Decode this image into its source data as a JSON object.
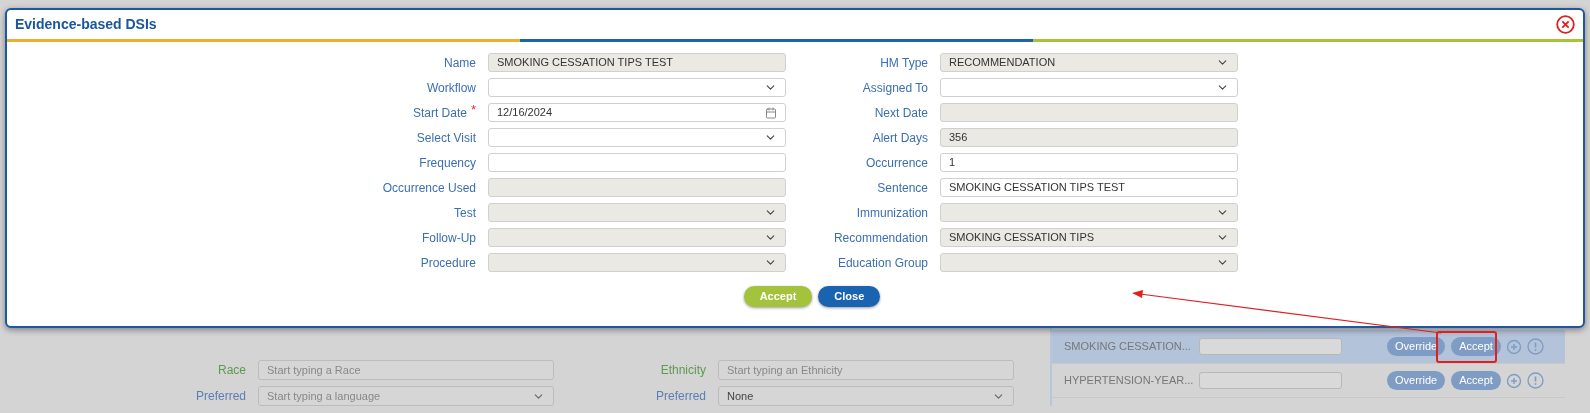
{
  "dialog": {
    "title": "Evidence-based DSIs",
    "fields_left": [
      {
        "label": "Name",
        "kind": "text",
        "value": "SMOKING CESSATION TIPS TEST",
        "disabled": true
      },
      {
        "label": "Workflow",
        "kind": "select",
        "disabled": false
      },
      {
        "label": "Start Date",
        "kind": "date",
        "value": "12/16/2024",
        "disabled": false,
        "marker": "*"
      },
      {
        "label": "Select Visit",
        "kind": "select",
        "disabled": false
      },
      {
        "label": "Frequency",
        "kind": "text",
        "disabled": false
      },
      {
        "label": "Occurrence Used",
        "kind": "text",
        "disabled": true
      },
      {
        "label": "Test",
        "kind": "select",
        "disabled": true
      },
      {
        "label": "Follow-Up",
        "kind": "select",
        "disabled": true
      },
      {
        "label": "Procedure",
        "kind": "select",
        "disabled": true
      }
    ],
    "fields_right": [
      {
        "label": "HM Type",
        "kind": "select",
        "value": "RECOMMENDATION",
        "disabled": true
      },
      {
        "label": "Assigned To",
        "kind": "select",
        "disabled": false
      },
      {
        "label": "Next Date",
        "kind": "text",
        "disabled": true
      },
      {
        "label": "Alert Days",
        "kind": "text",
        "value": "356",
        "disabled": true
      },
      {
        "label": "Occurrence",
        "kind": "text",
        "value": "1",
        "disabled": false
      },
      {
        "label": "Sentence",
        "kind": "text",
        "value": "SMOKING CESSATION TIPS TEST",
        "disabled": false
      },
      {
        "label": "Immunization",
        "kind": "select",
        "disabled": true
      },
      {
        "label": "Recommendation",
        "kind": "select",
        "value": "SMOKING CESSATION TIPS",
        "disabled": true
      },
      {
        "label": "Education Group",
        "kind": "select",
        "disabled": true
      }
    ],
    "buttons": [
      {
        "label": "Accept",
        "kind": "primary"
      },
      {
        "label": "Close",
        "kind": "secondary"
      }
    ]
  },
  "background_form": {
    "rows": [
      [
        {
          "label": "Race",
          "kind": "text",
          "placeholder": "Start typing a Race",
          "color": "#5c9a4e"
        },
        {
          "label": "Ethnicity",
          "kind": "text",
          "placeholder": "Start typing an Ethnicity",
          "color": "#5c9a4e"
        }
      ],
      [
        {
          "label": "Preferred",
          "kind": "select",
          "placeholder": "Start typing a language",
          "color": "#5b7fb3"
        },
        {
          "label": "Preferred",
          "kind": "select",
          "value": "None",
          "color": "#5b7fb3"
        }
      ]
    ]
  },
  "recommendations": [
    {
      "name": "SMOKING CESSATION...",
      "selected": true,
      "buttons": [
        "Override",
        "Accept"
      ]
    },
    {
      "name": "HYPERTENSION-YEAR...",
      "selected": false,
      "buttons": [
        "Override",
        "Accept"
      ]
    }
  ]
}
